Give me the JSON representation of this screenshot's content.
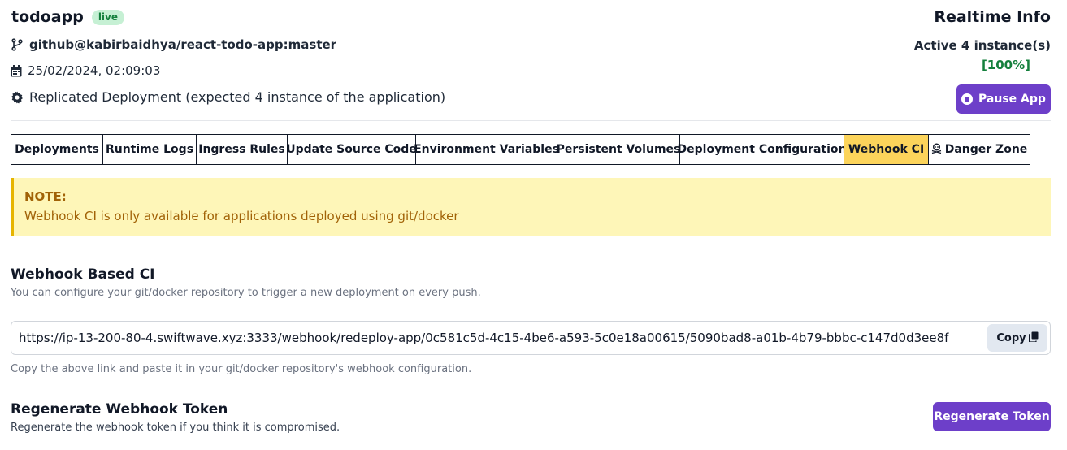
{
  "header": {
    "app_name": "todoapp",
    "status_badge": "live",
    "repo": "github@kabirbaidhya/react-todo-app:master",
    "date": "25/02/2024, 02:09:03",
    "deployment": "Replicated Deployment (expected 4 instance of the application)"
  },
  "realtime": {
    "title": "Realtime Info",
    "instances": "Active 4 instance(s)",
    "percent": "[100%]",
    "pause_label": "Pause App"
  },
  "tabs": [
    {
      "label": "Deployments"
    },
    {
      "label": "Runtime Logs"
    },
    {
      "label": "Ingress Rules"
    },
    {
      "label": "Update Source Code"
    },
    {
      "label": "Environment Variables"
    },
    {
      "label": "Persistent Volumes"
    },
    {
      "label": "Deployment Configuration"
    },
    {
      "label": "Webhook CI"
    },
    {
      "label": "Danger Zone"
    }
  ],
  "active_tab": "Webhook CI",
  "note": {
    "title": "NOTE:",
    "text": "Webhook CI is only available for applications deployed using git/docker"
  },
  "webhook": {
    "title": "Webhook Based CI",
    "description": "You can configure your git/docker repository to trigger a new deployment on every push.",
    "url": "https://ip-13-200-80-4.swiftwave.xyz:3333/webhook/redeploy-app/0c581c5d-4c15-4be6-a593-5c0e18a00615/5090bad8-a01b-4b79-bbbc-c147d0d3ee8f",
    "copy_label": "Copy",
    "hint": "Copy the above link and paste it in your git/docker repository's webhook configuration."
  },
  "regenerate": {
    "title": "Regenerate Webhook Token",
    "description": "Regenerate the webhook token if you think it is compromised.",
    "button_label": "Regenerate Token"
  },
  "colors": {
    "accent": "#6d3fc9",
    "active_tab": "#fcd45b",
    "note_bg": "#fef6b8",
    "note_text": "#a16207",
    "live_badge": "#c6f0d4",
    "success": "#15803d"
  },
  "icons": {
    "repo": "git-branch-icon",
    "date": "calendar-icon",
    "deployment": "gear-icon",
    "pause": "pause-circle-icon",
    "danger": "skull-icon",
    "copy": "copy-icon"
  }
}
